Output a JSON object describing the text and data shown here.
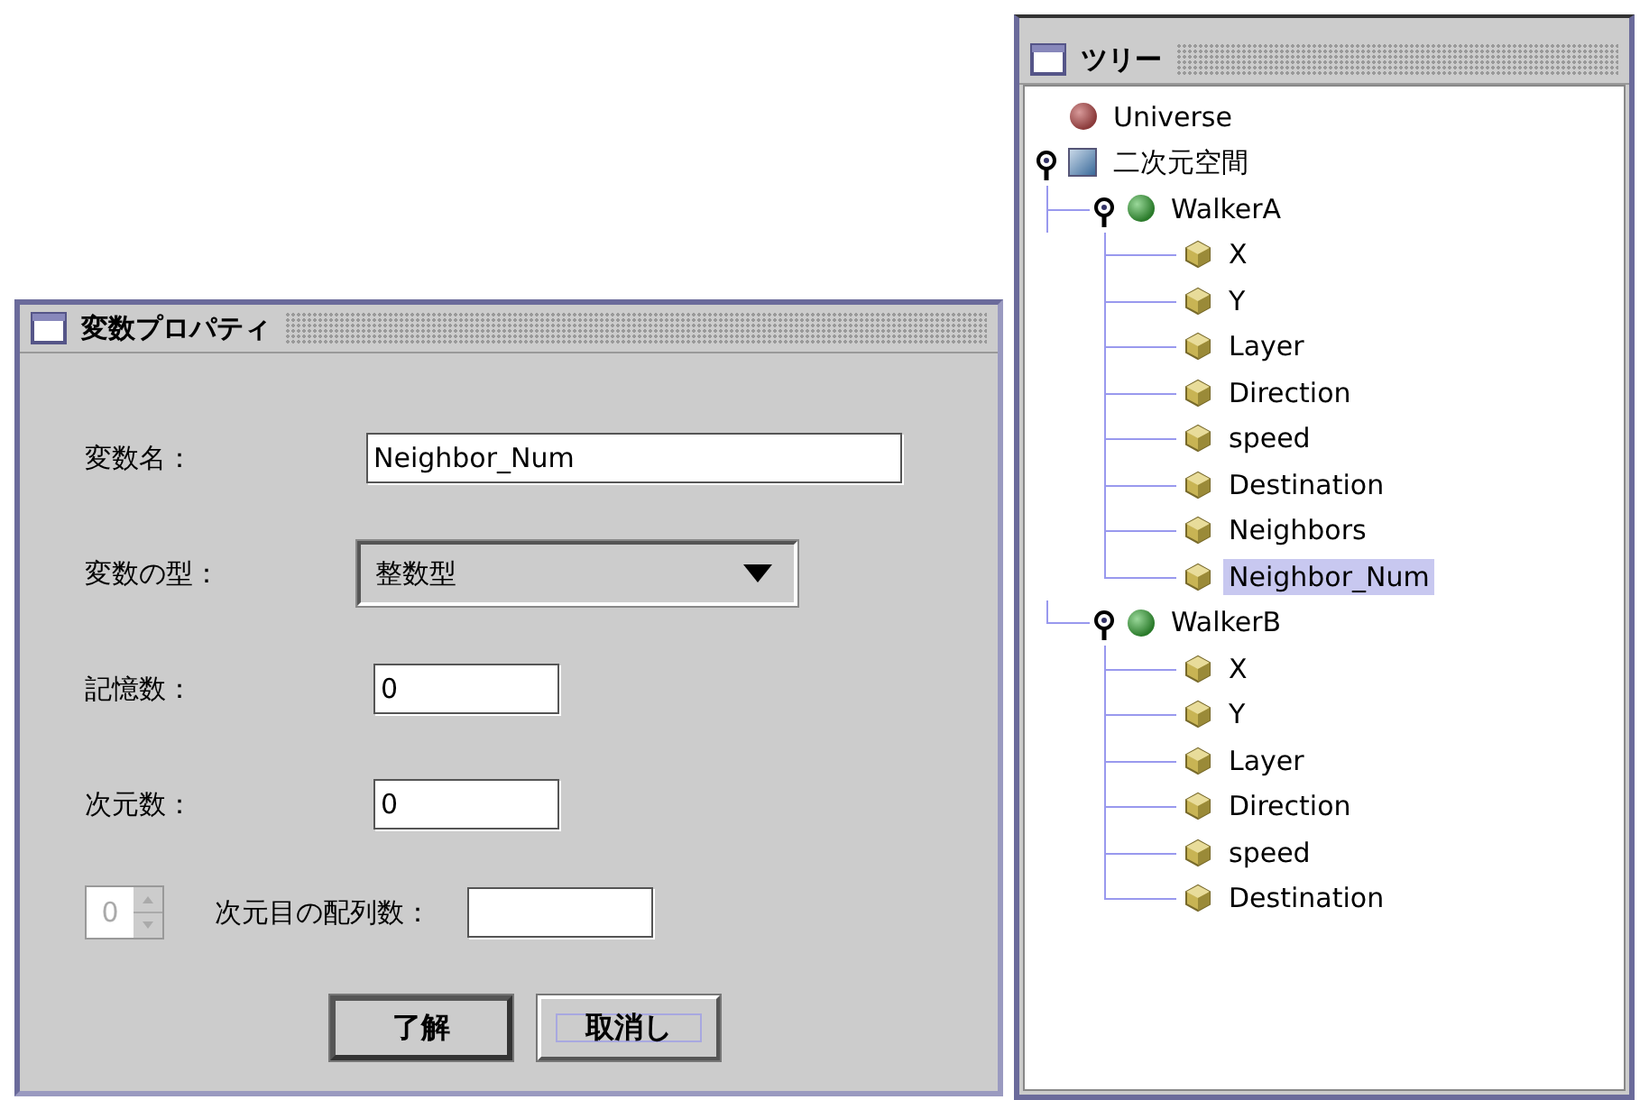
{
  "dialog": {
    "title": "変数プロパティ",
    "fields": [
      {
        "kind": "text",
        "label": "変数名：",
        "value": "Neighbor_Num"
      },
      {
        "kind": "select",
        "label": "変数の型：",
        "value": "整数型"
      },
      {
        "kind": "short",
        "label": "記憶数：",
        "value": "0"
      },
      {
        "kind": "short",
        "label": "次元数：",
        "value": "0"
      }
    ],
    "array_row": {
      "spinner": {
        "value": "0",
        "disabled": true
      },
      "label": "次元目の配列数："
    },
    "buttons": [
      {
        "label": "了解",
        "default": true,
        "focused": false
      },
      {
        "label": "取消し",
        "default": false,
        "focused": true
      }
    ]
  },
  "tree": {
    "title": "ツリー",
    "nodes": [
      {
        "label": "Universe",
        "kind": "universe",
        "selected": false
      },
      {
        "label": "二次元空間",
        "kind": "space",
        "selected": false,
        "expanded": true,
        "children": [
          {
            "label": "WalkerA",
            "kind": "agent",
            "selected": false,
            "expanded": true,
            "children": [
              {
                "label": "X",
                "kind": "variable",
                "selected": false
              },
              {
                "label": "Y",
                "kind": "variable",
                "selected": false
              },
              {
                "label": "Layer",
                "kind": "variable",
                "selected": false
              },
              {
                "label": "Direction",
                "kind": "variable",
                "selected": false
              },
              {
                "label": "speed",
                "kind": "variable",
                "selected": false
              },
              {
                "label": "Destination",
                "kind": "variable",
                "selected": false
              },
              {
                "label": "Neighbors",
                "kind": "variable",
                "selected": false
              },
              {
                "label": "Neighbor_Num",
                "kind": "variable",
                "selected": true
              }
            ]
          },
          {
            "label": "WalkerB",
            "kind": "agent",
            "selected": false,
            "expanded": true,
            "children": [
              {
                "label": "X",
                "kind": "variable",
                "selected": false
              },
              {
                "label": "Y",
                "kind": "variable",
                "selected": false
              },
              {
                "label": "Layer",
                "kind": "variable",
                "selected": false
              },
              {
                "label": "Direction",
                "kind": "variable",
                "selected": false
              },
              {
                "label": "speed",
                "kind": "variable",
                "selected": false
              },
              {
                "label": "Destination",
                "kind": "variable",
                "selected": false
              }
            ]
          }
        ]
      }
    ]
  }
}
